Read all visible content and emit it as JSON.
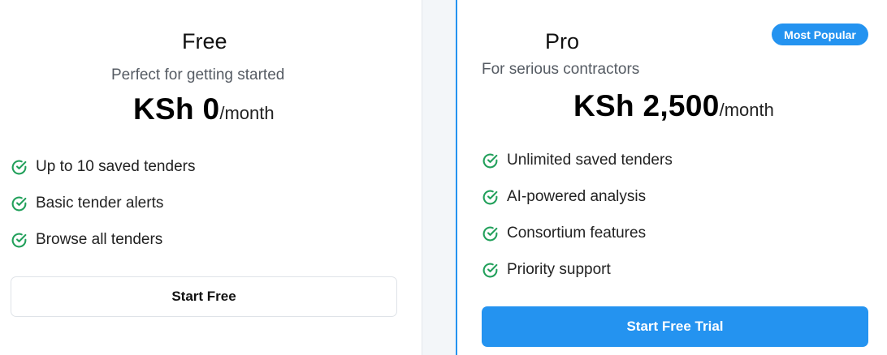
{
  "plans": {
    "free": {
      "name": "Free",
      "description": "Perfect for getting started",
      "price_amount": "KSh 0",
      "price_period": "/month",
      "features": [
        "Up to 10 saved tenders",
        "Basic tender alerts",
        "Browse all tenders"
      ],
      "cta_label": "Start Free"
    },
    "pro": {
      "badge": "Most Popular",
      "name": "Pro",
      "description": "For serious contractors",
      "price_amount": "KSh 2,500",
      "price_period": "/month",
      "features": [
        "Unlimited saved tenders",
        "AI-powered analysis",
        "Consortium features",
        "Priority support"
      ],
      "cta_label": "Start Free Trial"
    }
  },
  "icons": {
    "feature": "check-circle-icon"
  },
  "colors": {
    "accent": "#2493f0",
    "check": "#22a05b",
    "card_border": "#e3e7ec",
    "page_background": "#f3f6f9"
  }
}
